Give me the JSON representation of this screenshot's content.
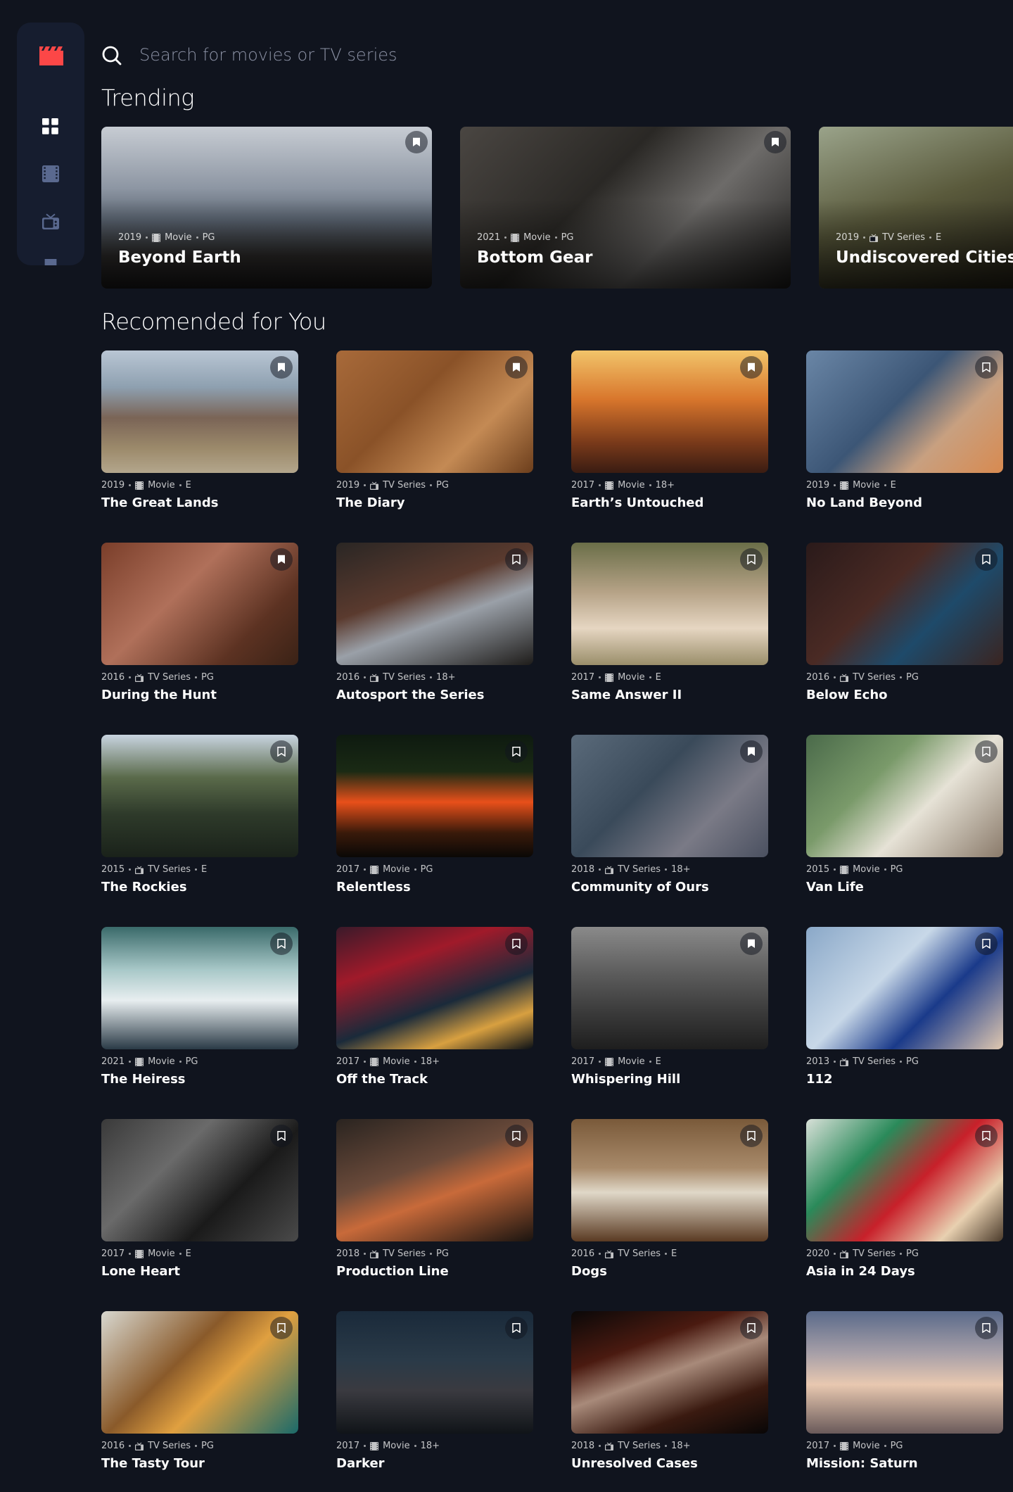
{
  "search": {
    "placeholder": "Search for movies or TV series"
  },
  "nav": {
    "icons": [
      "logo-icon",
      "home-icon",
      "movies-icon",
      "tv-series-icon",
      "bookmark-icon"
    ]
  },
  "sections": {
    "trending_title": "Trending",
    "recommended_title": "Recomended for You"
  },
  "colors": {
    "background": "#10141e",
    "sidebar": "#161d2f",
    "brand": "#fc4747",
    "muted": "#8d93a6"
  },
  "trending": [
    {
      "year": "2019",
      "category": "Movie",
      "rating": "PG",
      "title": "Beyond Earth",
      "bookmarked": true
    },
    {
      "year": "2021",
      "category": "Movie",
      "rating": "PG",
      "title": "Bottom Gear",
      "bookmarked": true
    },
    {
      "year": "2019",
      "category": "TV Series",
      "rating": "E",
      "title": "Undiscovered Cities",
      "bookmarked": false
    }
  ],
  "recommended": [
    {
      "year": "2019",
      "category": "Movie",
      "rating": "E",
      "title": "The Great Lands",
      "bookmarked": true
    },
    {
      "year": "2019",
      "category": "TV Series",
      "rating": "PG",
      "title": "The Diary",
      "bookmarked": true
    },
    {
      "year": "2017",
      "category": "Movie",
      "rating": "18+",
      "title": "Earth’s Untouched",
      "bookmarked": true
    },
    {
      "year": "2019",
      "category": "Movie",
      "rating": "E",
      "title": "No Land Beyond",
      "bookmarked": false
    },
    {
      "year": "2016",
      "category": "TV Series",
      "rating": "PG",
      "title": "During the Hunt",
      "bookmarked": true
    },
    {
      "year": "2016",
      "category": "TV Series",
      "rating": "18+",
      "title": "Autosport the Series",
      "bookmarked": false
    },
    {
      "year": "2017",
      "category": "Movie",
      "rating": "E",
      "title": "Same Answer II",
      "bookmarked": false
    },
    {
      "year": "2016",
      "category": "TV Series",
      "rating": "PG",
      "title": "Below Echo",
      "bookmarked": false
    },
    {
      "year": "2015",
      "category": "TV Series",
      "rating": "E",
      "title": "The Rockies",
      "bookmarked": false
    },
    {
      "year": "2017",
      "category": "Movie",
      "rating": "PG",
      "title": "Relentless",
      "bookmarked": false
    },
    {
      "year": "2018",
      "category": "TV Series",
      "rating": "18+",
      "title": "Community of Ours",
      "bookmarked": true
    },
    {
      "year": "2015",
      "category": "Movie",
      "rating": "PG",
      "title": "Van Life",
      "bookmarked": false
    },
    {
      "year": "2021",
      "category": "Movie",
      "rating": "PG",
      "title": "The Heiress",
      "bookmarked": false
    },
    {
      "year": "2017",
      "category": "Movie",
      "rating": "18+",
      "title": "Off the Track",
      "bookmarked": false
    },
    {
      "year": "2017",
      "category": "Movie",
      "rating": "E",
      "title": "Whispering Hill",
      "bookmarked": true
    },
    {
      "year": "2013",
      "category": "TV Series",
      "rating": "PG",
      "title": "112",
      "bookmarked": false
    },
    {
      "year": "2017",
      "category": "Movie",
      "rating": "E",
      "title": "Lone Heart",
      "bookmarked": false
    },
    {
      "year": "2018",
      "category": "TV Series",
      "rating": "PG",
      "title": "Production Line",
      "bookmarked": false
    },
    {
      "year": "2016",
      "category": "TV Series",
      "rating": "E",
      "title": "Dogs",
      "bookmarked": false
    },
    {
      "year": "2020",
      "category": "TV Series",
      "rating": "PG",
      "title": "Asia in 24 Days",
      "bookmarked": false
    },
    {
      "year": "2016",
      "category": "TV Series",
      "rating": "PG",
      "title": "The Tasty Tour",
      "bookmarked": false
    },
    {
      "year": "2017",
      "category": "Movie",
      "rating": "18+",
      "title": "Darker",
      "bookmarked": false
    },
    {
      "year": "2018",
      "category": "TV Series",
      "rating": "18+",
      "title": "Unresolved Cases",
      "bookmarked": false
    },
    {
      "year": "2017",
      "category": "Movie",
      "rating": "PG",
      "title": "Mission: Saturn",
      "bookmarked": false
    }
  ]
}
